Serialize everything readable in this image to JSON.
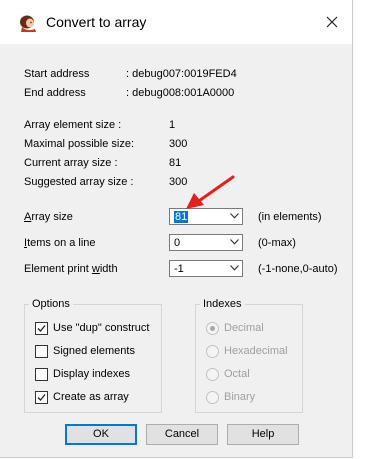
{
  "dialog": {
    "title": "Convert to array",
    "close_glyph": "✕"
  },
  "info": {
    "start_label": "Start address",
    "start_value": ": debug007:0019FED4",
    "end_label": "End address",
    "end_value": ": debug008:001A0000",
    "elem_size_label": "Array element size :",
    "elem_size_value": "1",
    "max_size_label": "Maximal possible size:",
    "max_size_value": "300",
    "cur_size_label": "Current array size :",
    "cur_size_value": "81",
    "sug_size_label": "Suggested array size :",
    "sug_size_value": "300"
  },
  "fields": {
    "array_size": {
      "label_u": "A",
      "label_rest": "rray size",
      "value": "81",
      "hint": "(in elements)"
    },
    "items_line": {
      "label_u": "I",
      "label_rest": "tems on a line",
      "value": "0",
      "hint": "(0-max)"
    },
    "print_width": {
      "label_pre": "Element print ",
      "label_u": "w",
      "label_rest": "idth",
      "value": "-1",
      "hint": "(-1-none,0-auto)"
    }
  },
  "options": {
    "title": "Options",
    "items": [
      {
        "label": "Use \"dup\" construct",
        "checked": true
      },
      {
        "label": "Signed elements",
        "checked": false
      },
      {
        "label": "Display indexes",
        "checked": false
      },
      {
        "label": "Create as array",
        "checked": true
      }
    ]
  },
  "indexes": {
    "title": "Indexes",
    "items": [
      {
        "label": "Decimal",
        "selected": true
      },
      {
        "label": "Hexadecimal",
        "selected": false
      },
      {
        "label": "Octal",
        "selected": false
      },
      {
        "label": "Binary",
        "selected": false
      }
    ]
  },
  "buttons": {
    "ok": "OK",
    "cancel": "Cancel",
    "help": "Help"
  },
  "colors": {
    "accent": "#0078d7",
    "annotation_arrow": "#e81e1e"
  },
  "icons": {
    "app": "ida-app-icon",
    "close": "close-icon",
    "chevron": "chevron-down-icon",
    "check": "check-icon"
  }
}
